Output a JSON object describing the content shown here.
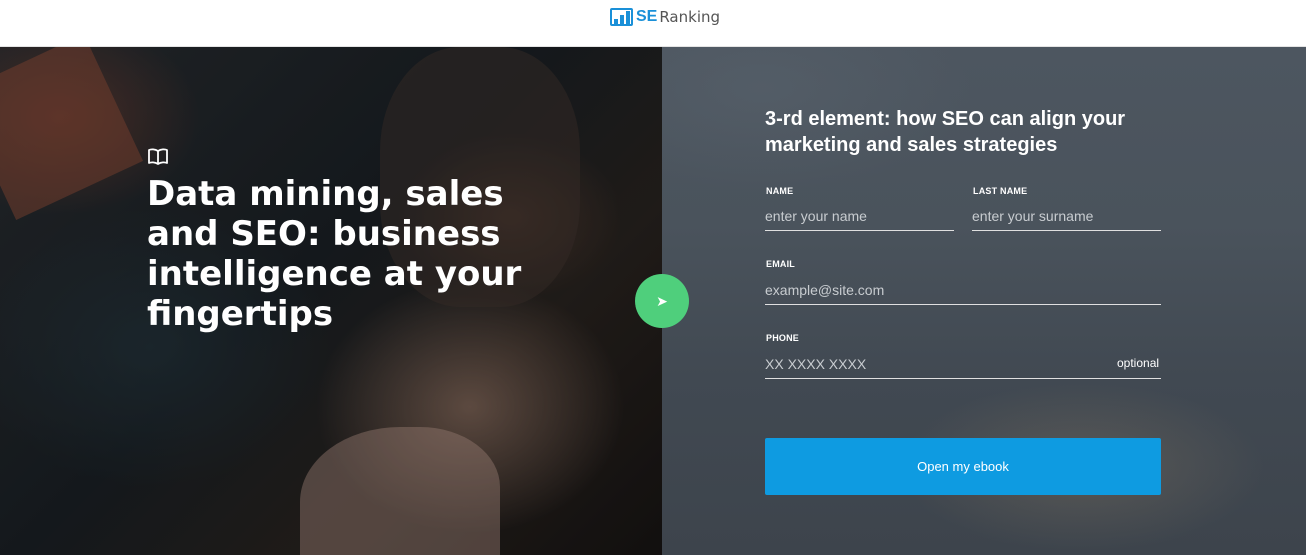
{
  "header": {
    "logo": {
      "brand_part1": "SE",
      "brand_part2": "Ranking",
      "icon": "bar-chart-logo-icon",
      "color": "#1a90d8"
    }
  },
  "hero": {
    "icon": "book-icon",
    "headline": "Data mining, sales and SEO: business intelligence at your fingertips",
    "play_icon": "play-icon",
    "play_color": "#4fcf7c"
  },
  "form": {
    "title": "3-rd element: how SEO can align your marketing and sales strategies",
    "name": {
      "label": "NAME",
      "placeholder": "enter your name",
      "value": ""
    },
    "last_name": {
      "label": "LAST NAME",
      "placeholder": "enter your surname",
      "value": ""
    },
    "email": {
      "label": "EMAIL",
      "placeholder": "example@site.com",
      "value": ""
    },
    "phone": {
      "label": "PHONE",
      "placeholder": "XX XXXX XXXX",
      "value": "",
      "hint": "optional"
    },
    "submit_label": "Open my ebook",
    "submit_color": "#0e9be1"
  }
}
